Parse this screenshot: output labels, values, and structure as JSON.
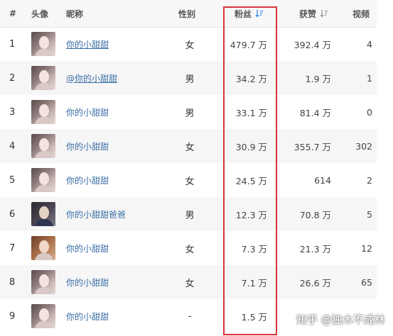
{
  "header": {
    "index": "#",
    "avatar": "头像",
    "nickname": "昵称",
    "gender": "性别",
    "fans": "粉丝",
    "likes": "获赞",
    "videos": "视频",
    "fans_sort_color": "#3a8ee6",
    "likes_sort_color": "#999999"
  },
  "rows": [
    {
      "index": "1",
      "nickname": "你的小甜甜",
      "gender": "女",
      "fans": "479.7 万",
      "likes": "392.4 万",
      "videos": "4",
      "avatar": "girl-avatar-icon"
    },
    {
      "index": "2",
      "nickname": "@你的小甜甜",
      "gender": "男",
      "fans": "34.2 万",
      "likes": "1.9 万",
      "videos": "1",
      "avatar": "girl-avatar-icon"
    },
    {
      "index": "3",
      "nickname": "你的小甜甜",
      "gender": "男",
      "fans": "33.1 万",
      "likes": "81.4 万",
      "videos": "0",
      "avatar": "girl-avatar-icon"
    },
    {
      "index": "4",
      "nickname": "你的小甜甜",
      "gender": "女",
      "fans": "30.9 万",
      "likes": "355.7 万",
      "videos": "302",
      "avatar": "girl-avatar-icon"
    },
    {
      "index": "5",
      "nickname": "你的小甜甜",
      "gender": "女",
      "fans": "24.5 万",
      "likes": "614",
      "videos": "2",
      "avatar": "girl-avatar-icon"
    },
    {
      "index": "6",
      "nickname": "你的小甜甜爸爸",
      "gender": "男",
      "fans": "12.3 万",
      "likes": "70.8 万",
      "videos": "5",
      "avatar": "boy-avatar-icon"
    },
    {
      "index": "7",
      "nickname": "你的小甜甜",
      "gender": "女",
      "fans": "7.3 万",
      "likes": "21.3 万",
      "videos": "12",
      "avatar": "girl-avatar-icon"
    },
    {
      "index": "8",
      "nickname": "你的小甜甜",
      "gender": "女",
      "fans": "7.1 万",
      "likes": "26.6 万",
      "videos": "65",
      "avatar": "girl-avatar-icon"
    },
    {
      "index": "9",
      "nickname": "你的小甜甜",
      "gender": "-",
      "fans": "1.5 万",
      "likes": "",
      "videos": "",
      "avatar": "girl-avatar-icon"
    }
  ],
  "highlight_color": "#d8343a",
  "watermark": "知乎 @独木不成林"
}
